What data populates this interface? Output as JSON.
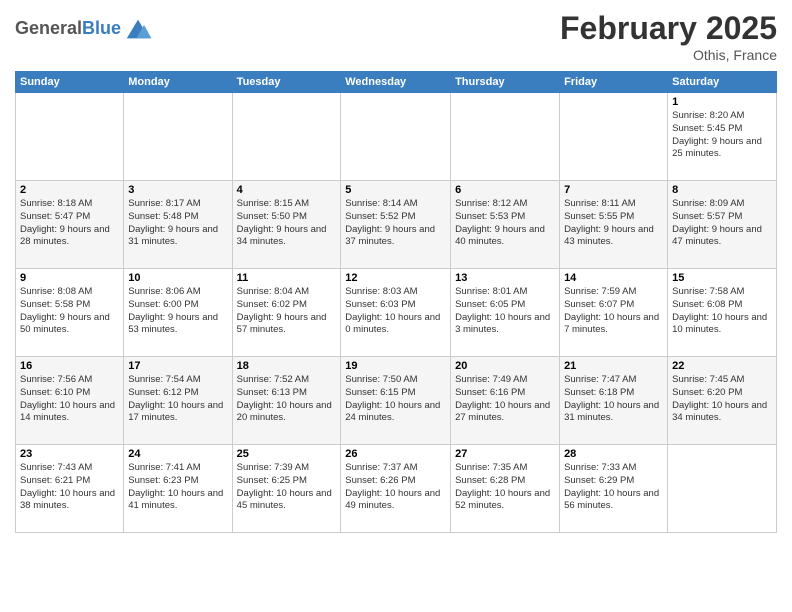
{
  "header": {
    "logo_line1": "General",
    "logo_line2": "Blue",
    "month": "February 2025",
    "location": "Othis, France"
  },
  "days_of_week": [
    "Sunday",
    "Monday",
    "Tuesday",
    "Wednesday",
    "Thursday",
    "Friday",
    "Saturday"
  ],
  "weeks": [
    [
      {
        "day": "",
        "detail": ""
      },
      {
        "day": "",
        "detail": ""
      },
      {
        "day": "",
        "detail": ""
      },
      {
        "day": "",
        "detail": ""
      },
      {
        "day": "",
        "detail": ""
      },
      {
        "day": "",
        "detail": ""
      },
      {
        "day": "1",
        "detail": "Sunrise: 8:20 AM\nSunset: 5:45 PM\nDaylight: 9 hours and 25 minutes."
      }
    ],
    [
      {
        "day": "2",
        "detail": "Sunrise: 8:18 AM\nSunset: 5:47 PM\nDaylight: 9 hours and 28 minutes."
      },
      {
        "day": "3",
        "detail": "Sunrise: 8:17 AM\nSunset: 5:48 PM\nDaylight: 9 hours and 31 minutes."
      },
      {
        "day": "4",
        "detail": "Sunrise: 8:15 AM\nSunset: 5:50 PM\nDaylight: 9 hours and 34 minutes."
      },
      {
        "day": "5",
        "detail": "Sunrise: 8:14 AM\nSunset: 5:52 PM\nDaylight: 9 hours and 37 minutes."
      },
      {
        "day": "6",
        "detail": "Sunrise: 8:12 AM\nSunset: 5:53 PM\nDaylight: 9 hours and 40 minutes."
      },
      {
        "day": "7",
        "detail": "Sunrise: 8:11 AM\nSunset: 5:55 PM\nDaylight: 9 hours and 43 minutes."
      },
      {
        "day": "8",
        "detail": "Sunrise: 8:09 AM\nSunset: 5:57 PM\nDaylight: 9 hours and 47 minutes."
      }
    ],
    [
      {
        "day": "9",
        "detail": "Sunrise: 8:08 AM\nSunset: 5:58 PM\nDaylight: 9 hours and 50 minutes."
      },
      {
        "day": "10",
        "detail": "Sunrise: 8:06 AM\nSunset: 6:00 PM\nDaylight: 9 hours and 53 minutes."
      },
      {
        "day": "11",
        "detail": "Sunrise: 8:04 AM\nSunset: 6:02 PM\nDaylight: 9 hours and 57 minutes."
      },
      {
        "day": "12",
        "detail": "Sunrise: 8:03 AM\nSunset: 6:03 PM\nDaylight: 10 hours and 0 minutes."
      },
      {
        "day": "13",
        "detail": "Sunrise: 8:01 AM\nSunset: 6:05 PM\nDaylight: 10 hours and 3 minutes."
      },
      {
        "day": "14",
        "detail": "Sunrise: 7:59 AM\nSunset: 6:07 PM\nDaylight: 10 hours and 7 minutes."
      },
      {
        "day": "15",
        "detail": "Sunrise: 7:58 AM\nSunset: 6:08 PM\nDaylight: 10 hours and 10 minutes."
      }
    ],
    [
      {
        "day": "16",
        "detail": "Sunrise: 7:56 AM\nSunset: 6:10 PM\nDaylight: 10 hours and 14 minutes."
      },
      {
        "day": "17",
        "detail": "Sunrise: 7:54 AM\nSunset: 6:12 PM\nDaylight: 10 hours and 17 minutes."
      },
      {
        "day": "18",
        "detail": "Sunrise: 7:52 AM\nSunset: 6:13 PM\nDaylight: 10 hours and 20 minutes."
      },
      {
        "day": "19",
        "detail": "Sunrise: 7:50 AM\nSunset: 6:15 PM\nDaylight: 10 hours and 24 minutes."
      },
      {
        "day": "20",
        "detail": "Sunrise: 7:49 AM\nSunset: 6:16 PM\nDaylight: 10 hours and 27 minutes."
      },
      {
        "day": "21",
        "detail": "Sunrise: 7:47 AM\nSunset: 6:18 PM\nDaylight: 10 hours and 31 minutes."
      },
      {
        "day": "22",
        "detail": "Sunrise: 7:45 AM\nSunset: 6:20 PM\nDaylight: 10 hours and 34 minutes."
      }
    ],
    [
      {
        "day": "23",
        "detail": "Sunrise: 7:43 AM\nSunset: 6:21 PM\nDaylight: 10 hours and 38 minutes."
      },
      {
        "day": "24",
        "detail": "Sunrise: 7:41 AM\nSunset: 6:23 PM\nDaylight: 10 hours and 41 minutes."
      },
      {
        "day": "25",
        "detail": "Sunrise: 7:39 AM\nSunset: 6:25 PM\nDaylight: 10 hours and 45 minutes."
      },
      {
        "day": "26",
        "detail": "Sunrise: 7:37 AM\nSunset: 6:26 PM\nDaylight: 10 hours and 49 minutes."
      },
      {
        "day": "27",
        "detail": "Sunrise: 7:35 AM\nSunset: 6:28 PM\nDaylight: 10 hours and 52 minutes."
      },
      {
        "day": "28",
        "detail": "Sunrise: 7:33 AM\nSunset: 6:29 PM\nDaylight: 10 hours and 56 minutes."
      },
      {
        "day": "",
        "detail": ""
      }
    ]
  ]
}
